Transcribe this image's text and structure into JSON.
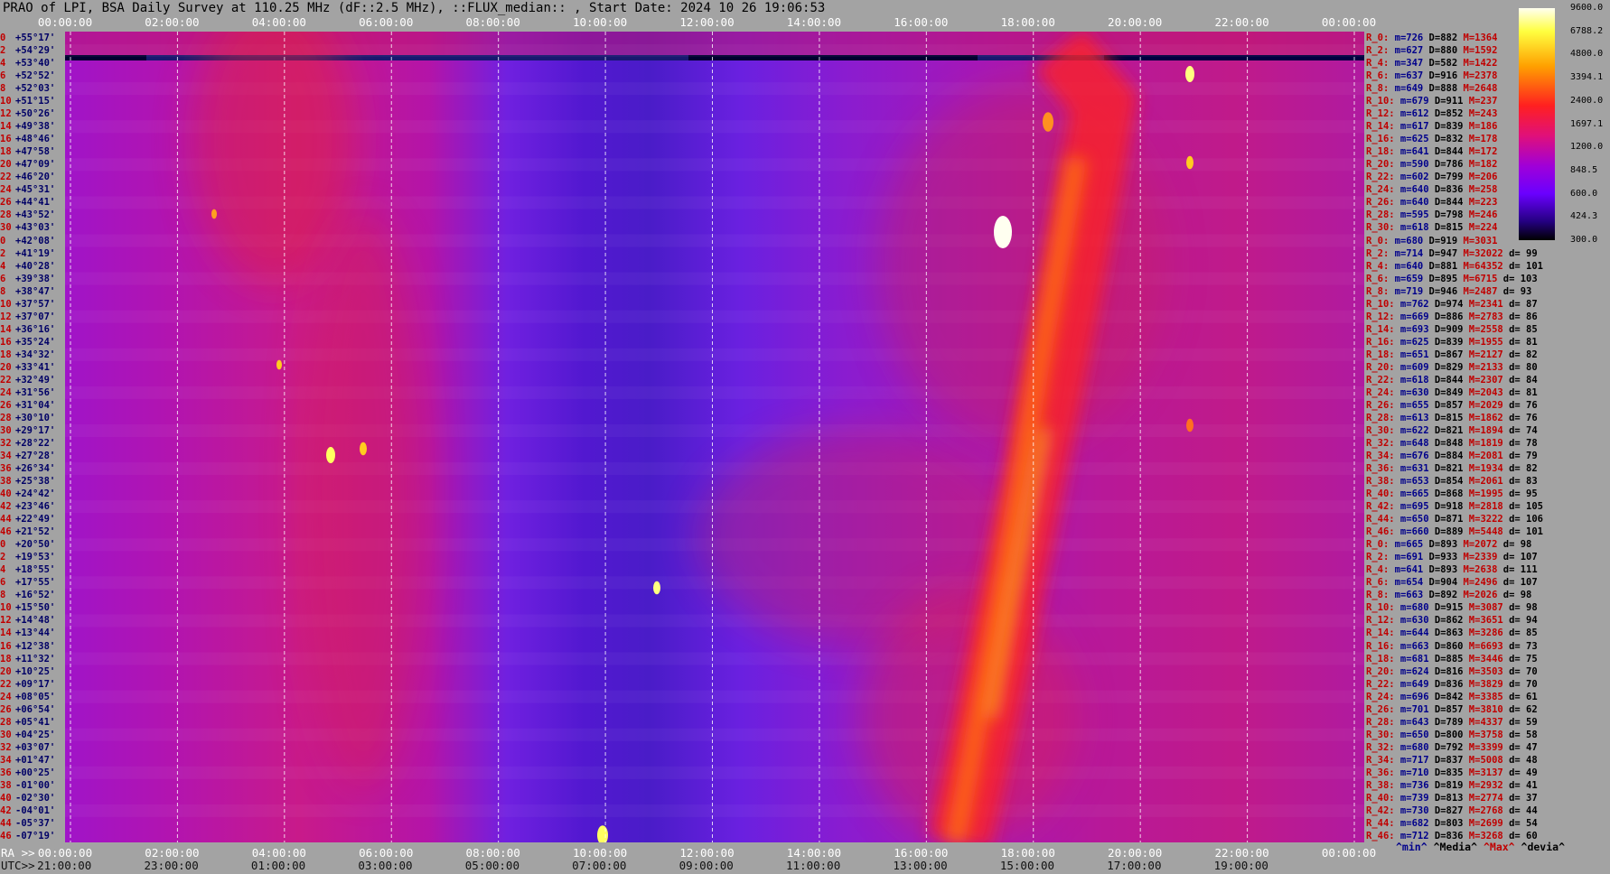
{
  "title": "PRAO of LPI, BSA Daily Survey at 110.25 MHz (dF::2.5 MHz), ::FLUX_median:: , Start Date: 2024 10 26 19:06:53",
  "chart_data": {
    "type": "heatmap",
    "top_ticks": [
      "00:00:00",
      "02:00:00",
      "04:00:00",
      "06:00:00",
      "08:00:00",
      "10:00:00",
      "12:00:00",
      "14:00:00",
      "16:00:00",
      "18:00:00",
      "20:00:00",
      "22:00:00",
      "00:00:00"
    ],
    "ra_prefix": "RA >>",
    "ra_ticks": [
      "00:00:00",
      "02:00:00",
      "04:00:00",
      "06:00:00",
      "08:00:00",
      "10:00:00",
      "12:00:00",
      "14:00:00",
      "16:00:00",
      "18:00:00",
      "20:00:00",
      "22:00:00",
      "00:00:00"
    ],
    "utc_prefix": "UTC>>",
    "utc_ticks": [
      "21:00:00",
      "23:00:00",
      "01:00:00",
      "03:00:00",
      "05:00:00",
      "07:00:00",
      "09:00:00",
      "11:00:00",
      "13:00:00",
      "15:00:00",
      "17:00:00",
      "19:00:00"
    ],
    "colorbar_labels": [
      "9600.0",
      "6788.2",
      "4800.0",
      "3394.1",
      "2400.0",
      "1697.1",
      "1200.0",
      "848.5",
      "600.0",
      "424.3",
      "300.0"
    ],
    "colorbar_range": [
      300,
      9600
    ],
    "colorbar_scale": "log",
    "declinations": [
      "+55°17'",
      "+54°29'",
      "+53°40'",
      "+52°52'",
      "+52°03'",
      "+51°15'",
      "+50°26'",
      "+49°38'",
      "+48°46'",
      "+47°58'",
      "+47°09'",
      "+46°20'",
      "+45°31'",
      "+44°41'",
      "+43°52'",
      "+43°03'",
      "+42°08'",
      "+41°19'",
      "+40°28'",
      "+39°38'",
      "+38°47'",
      "+37°57'",
      "+37°07'",
      "+36°16'",
      "+35°24'",
      "+34°32'",
      "+33°41'",
      "+32°49'",
      "+31°56'",
      "+31°04'",
      "+30°10'",
      "+29°17'",
      "+28°22'",
      "+27°28'",
      "+26°34'",
      "+25°38'",
      "+24°42'",
      "+23°46'",
      "+22°49'",
      "+21°52'",
      "+20°50'",
      "+19°53'",
      "+18°55'",
      "+17°55'",
      "+16°52'",
      "+15°50'",
      "+14°48'",
      "+13°44'",
      "+12°38'",
      "+11°32'",
      "+10°25'",
      "+09°17'",
      "+08°05'",
      "+06°54'",
      "+05°41'",
      "+04°25'",
      "+03°07'",
      "+01°47'",
      "+00°25'",
      "-01°00'",
      "-02°30'",
      "-04°01'",
      "-05°37'",
      "-07°19'"
    ],
    "row_indices": [
      "0",
      "2",
      "4",
      "6",
      "8",
      "10",
      "12",
      "14",
      "16",
      "18",
      "20",
      "22",
      "24",
      "26",
      "28",
      "30",
      "0",
      "2",
      "4",
      "6",
      "8",
      "10",
      "12",
      "14",
      "16",
      "18",
      "20",
      "22",
      "24",
      "26",
      "28",
      "30",
      "32",
      "34",
      "36",
      "38",
      "40",
      "42",
      "44",
      "46",
      "0",
      "2",
      "4",
      "6",
      "8",
      "10",
      "12",
      "14",
      "16",
      "18",
      "20",
      "22",
      "24",
      "26",
      "28",
      "30",
      "32",
      "34",
      "36",
      "38",
      "40",
      "42",
      "44",
      "46"
    ],
    "stats": [
      {
        "r": "R_0:",
        "m": "m=726",
        "d": "D=882",
        "M": "M=1364",
        "dd": ""
      },
      {
        "r": "R_2:",
        "m": "m=627",
        "d": "D=880",
        "M": "M=1592",
        "dd": ""
      },
      {
        "r": "R_4:",
        "m": "m=347",
        "d": "D=582",
        "M": "M=1422",
        "dd": ""
      },
      {
        "r": "R_6:",
        "m": "m=637",
        "d": "D=916",
        "M": "M=2378",
        "dd": ""
      },
      {
        "r": "R_8:",
        "m": "m=649",
        "d": "D=888",
        "M": "M=2648",
        "dd": ""
      },
      {
        "r": "R_10:",
        "m": "m=679",
        "d": "D=911",
        "M": "M=237",
        "dd": ""
      },
      {
        "r": "R_12:",
        "m": "m=612",
        "d": "D=852",
        "M": "M=243",
        "dd": ""
      },
      {
        "r": "R_14:",
        "m": "m=617",
        "d": "D=839",
        "M": "M=186",
        "dd": ""
      },
      {
        "r": "R_16:",
        "m": "m=625",
        "d": "D=832",
        "M": "M=178",
        "dd": ""
      },
      {
        "r": "R_18:",
        "m": "m=641",
        "d": "D=844",
        "M": "M=172",
        "dd": ""
      },
      {
        "r": "R_20:",
        "m": "m=590",
        "d": "D=786",
        "M": "M=182",
        "dd": ""
      },
      {
        "r": "R_22:",
        "m": "m=602",
        "d": "D=799",
        "M": "M=206",
        "dd": ""
      },
      {
        "r": "R_24:",
        "m": "m=640",
        "d": "D=836",
        "M": "M=258",
        "dd": ""
      },
      {
        "r": "R_26:",
        "m": "m=640",
        "d": "D=844",
        "M": "M=223",
        "dd": ""
      },
      {
        "r": "R_28:",
        "m": "m=595",
        "d": "D=798",
        "M": "M=246",
        "dd": ""
      },
      {
        "r": "R_30:",
        "m": "m=618",
        "d": "D=815",
        "M": "M=224",
        "dd": ""
      },
      {
        "r": "R_0:",
        "m": "m=680",
        "d": "D=919",
        "M": "M=3031",
        "dd": ""
      },
      {
        "r": "R_2:",
        "m": "m=714",
        "d": "D=947",
        "M": "M=32022",
        "dd": "d= 99"
      },
      {
        "r": "R_4:",
        "m": "m=640",
        "d": "D=881",
        "M": "M=64352",
        "dd": "d= 101"
      },
      {
        "r": "R_6:",
        "m": "m=659",
        "d": "D=895",
        "M": "M=6715",
        "dd": "d= 103"
      },
      {
        "r": "R_8:",
        "m": "m=719",
        "d": "D=946",
        "M": "M=2487",
        "dd": "d= 93"
      },
      {
        "r": "R_10:",
        "m": "m=762",
        "d": "D=974",
        "M": "M=2341",
        "dd": "d= 87"
      },
      {
        "r": "R_12:",
        "m": "m=669",
        "d": "D=886",
        "M": "M=2783",
        "dd": "d= 86"
      },
      {
        "r": "R_14:",
        "m": "m=693",
        "d": "D=909",
        "M": "M=2558",
        "dd": "d= 85"
      },
      {
        "r": "R_16:",
        "m": "m=625",
        "d": "D=839",
        "M": "M=1955",
        "dd": "d= 81"
      },
      {
        "r": "R_18:",
        "m": "m=651",
        "d": "D=867",
        "M": "M=2127",
        "dd": "d= 82"
      },
      {
        "r": "R_20:",
        "m": "m=609",
        "d": "D=829",
        "M": "M=2133",
        "dd": "d= 80"
      },
      {
        "r": "R_22:",
        "m": "m=618",
        "d": "D=844",
        "M": "M=2307",
        "dd": "d= 84"
      },
      {
        "r": "R_24:",
        "m": "m=630",
        "d": "D=849",
        "M": "M=2043",
        "dd": "d= 81"
      },
      {
        "r": "R_26:",
        "m": "m=655",
        "d": "D=857",
        "M": "M=2029",
        "dd": "d= 76"
      },
      {
        "r": "R_28:",
        "m": "m=613",
        "d": "D=815",
        "M": "M=1862",
        "dd": "d= 76"
      },
      {
        "r": "R_30:",
        "m": "m=622",
        "d": "D=821",
        "M": "M=1894",
        "dd": "d= 74"
      },
      {
        "r": "R_32:",
        "m": "m=648",
        "d": "D=848",
        "M": "M=1819",
        "dd": "d= 78"
      },
      {
        "r": "R_34:",
        "m": "m=676",
        "d": "D=884",
        "M": "M=2081",
        "dd": "d= 79"
      },
      {
        "r": "R_36:",
        "m": "m=631",
        "d": "D=821",
        "M": "M=1934",
        "dd": "d= 82"
      },
      {
        "r": "R_38:",
        "m": "m=653",
        "d": "D=854",
        "M": "M=2061",
        "dd": "d= 83"
      },
      {
        "r": "R_40:",
        "m": "m=665",
        "d": "D=868",
        "M": "M=1995",
        "dd": "d= 95"
      },
      {
        "r": "R_42:",
        "m": "m=695",
        "d": "D=918",
        "M": "M=2818",
        "dd": "d= 105"
      },
      {
        "r": "R_44:",
        "m": "m=650",
        "d": "D=871",
        "M": "M=3222",
        "dd": "d= 106"
      },
      {
        "r": "R_46:",
        "m": "m=660",
        "d": "D=889",
        "M": "M=5448",
        "dd": "d= 101"
      },
      {
        "r": "R_0:",
        "m": "m=665",
        "d": "D=893",
        "M": "M=2072",
        "dd": "d= 98"
      },
      {
        "r": "R_2:",
        "m": "m=691",
        "d": "D=933",
        "M": "M=2339",
        "dd": "d= 107"
      },
      {
        "r": "R_4:",
        "m": "m=641",
        "d": "D=893",
        "M": "M=2638",
        "dd": "d= 111"
      },
      {
        "r": "R_6:",
        "m": "m=654",
        "d": "D=904",
        "M": "M=2496",
        "dd": "d= 107"
      },
      {
        "r": "R_8:",
        "m": "m=663",
        "d": "D=892",
        "M": "M=2026",
        "dd": "d= 98"
      },
      {
        "r": "R_10:",
        "m": "m=680",
        "d": "D=915",
        "M": "M=3087",
        "dd": "d= 98"
      },
      {
        "r": "R_12:",
        "m": "m=630",
        "d": "D=862",
        "M": "M=3651",
        "dd": "d= 94"
      },
      {
        "r": "R_14:",
        "m": "m=644",
        "d": "D=863",
        "M": "M=3286",
        "dd": "d= 85"
      },
      {
        "r": "R_16:",
        "m": "m=663",
        "d": "D=860",
        "M": "M=6693",
        "dd": "d= 73"
      },
      {
        "r": "R_18:",
        "m": "m=681",
        "d": "D=885",
        "M": "M=3446",
        "dd": "d= 75"
      },
      {
        "r": "R_20:",
        "m": "m=624",
        "d": "D=816",
        "M": "M=3503",
        "dd": "d= 70"
      },
      {
        "r": "R_22:",
        "m": "m=649",
        "d": "D=836",
        "M": "M=3829",
        "dd": "d= 70"
      },
      {
        "r": "R_24:",
        "m": "m=696",
        "d": "D=842",
        "M": "M=3385",
        "dd": "d= 61"
      },
      {
        "r": "R_26:",
        "m": "m=701",
        "d": "D=857",
        "M": "M=3810",
        "dd": "d= 62"
      },
      {
        "r": "R_28:",
        "m": "m=643",
        "d": "D=789",
        "M": "M=4337",
        "dd": "d= 59"
      },
      {
        "r": "R_30:",
        "m": "m=650",
        "d": "D=800",
        "M": "M=3758",
        "dd": "d= 58"
      },
      {
        "r": "R_32:",
        "m": "m=680",
        "d": "D=792",
        "M": "M=3399",
        "dd": "d= 47"
      },
      {
        "r": "R_34:",
        "m": "m=717",
        "d": "D=837",
        "M": "M=5008",
        "dd": "d= 48"
      },
      {
        "r": "R_36:",
        "m": "m=710",
        "d": "D=835",
        "M": "M=3137",
        "dd": "d= 49"
      },
      {
        "r": "R_38:",
        "m": "m=736",
        "d": "D=819",
        "M": "M=2932",
        "dd": "d= 41"
      },
      {
        "r": "R_40:",
        "m": "m=739",
        "d": "D=813",
        "M": "M=2774",
        "dd": "d= 37"
      },
      {
        "r": "R_42:",
        "m": "m=730",
        "d": "D=827",
        "M": "M=2768",
        "dd": "d= 44"
      },
      {
        "r": "R_44:",
        "m": "m=682",
        "d": "D=803",
        "M": "M=2699",
        "dd": "d= 54"
      },
      {
        "r": "R_46:",
        "m": "m=712",
        "d": "D=836",
        "M": "M=3268",
        "dd": "d= 60"
      }
    ],
    "stats_legend": [
      {
        "text": "^min^",
        "color": "#00008b"
      },
      {
        "text": "^Media^",
        "color": "#000000"
      },
      {
        "text": "^Max^",
        "color": "#c00000"
      },
      {
        "text": "^devia^",
        "color": "#000000"
      }
    ]
  }
}
